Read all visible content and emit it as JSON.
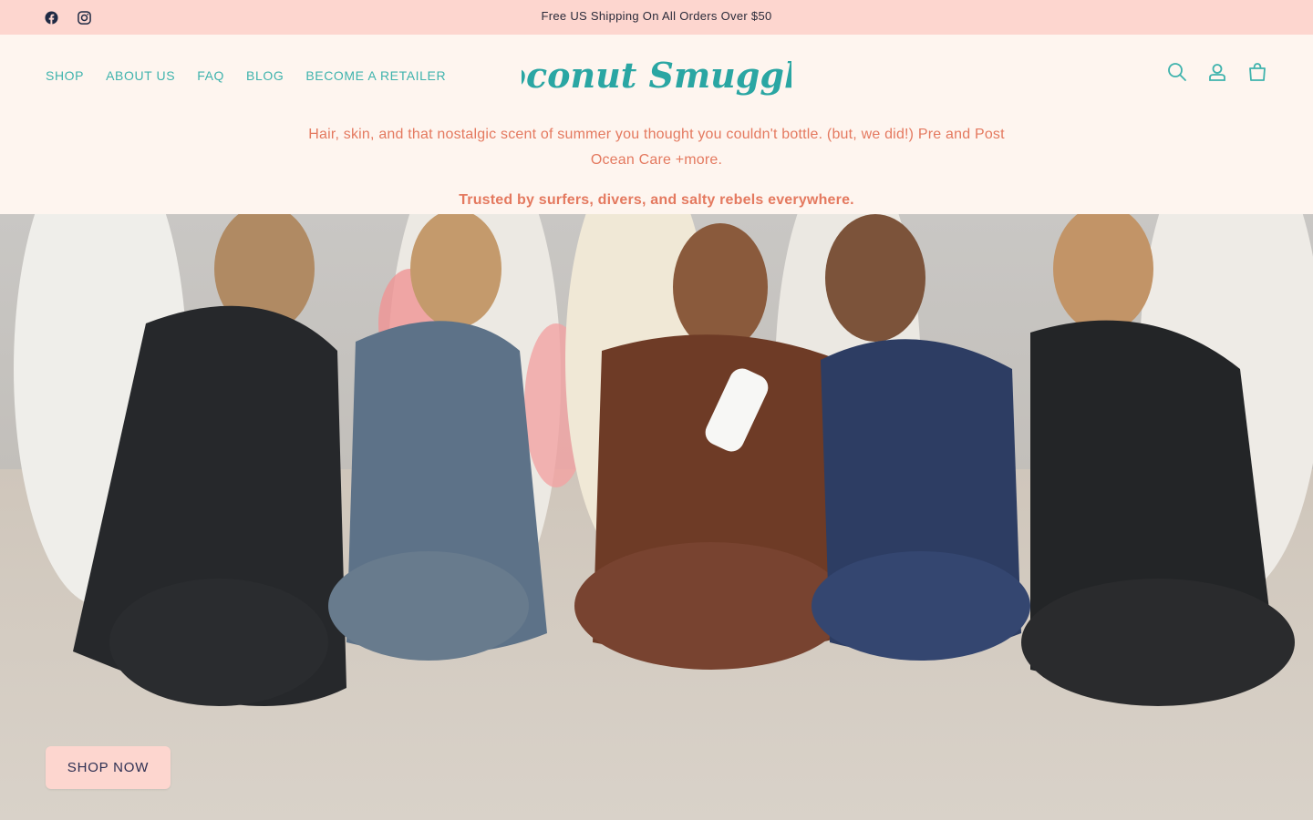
{
  "announcement": {
    "message": "Free US Shipping On All Orders Over $50",
    "social": [
      {
        "icon": "facebook-icon"
      },
      {
        "icon": "instagram-icon"
      }
    ]
  },
  "header": {
    "nav": [
      {
        "label": "SHOP"
      },
      {
        "label": "ABOUT US"
      },
      {
        "label": "FAQ"
      },
      {
        "label": "BLOG"
      },
      {
        "label": "BECOME A RETAILER"
      }
    ],
    "logo_text": "Coconut Smuggler",
    "icons": [
      "search-icon",
      "account-icon",
      "cart-icon"
    ]
  },
  "intro": {
    "tagline": "Hair, skin, and that nostalgic scent of summer you thought you couldn't bottle. (but, we did!) Pre and Post Ocean Care +more.",
    "trusted": "Trusted by surfers, divers, and salty rebels everywhere."
  },
  "hero": {
    "cta_label": "SHOP NOW"
  },
  "colors": {
    "announcement_bg": "#fdd6cf",
    "page_bg": "#fef5ef",
    "nav_teal": "#3fb3ad",
    "logo_teal": "#2aa6a3",
    "tagline_coral": "#e4795f",
    "cta_text": "#2d2f52"
  }
}
